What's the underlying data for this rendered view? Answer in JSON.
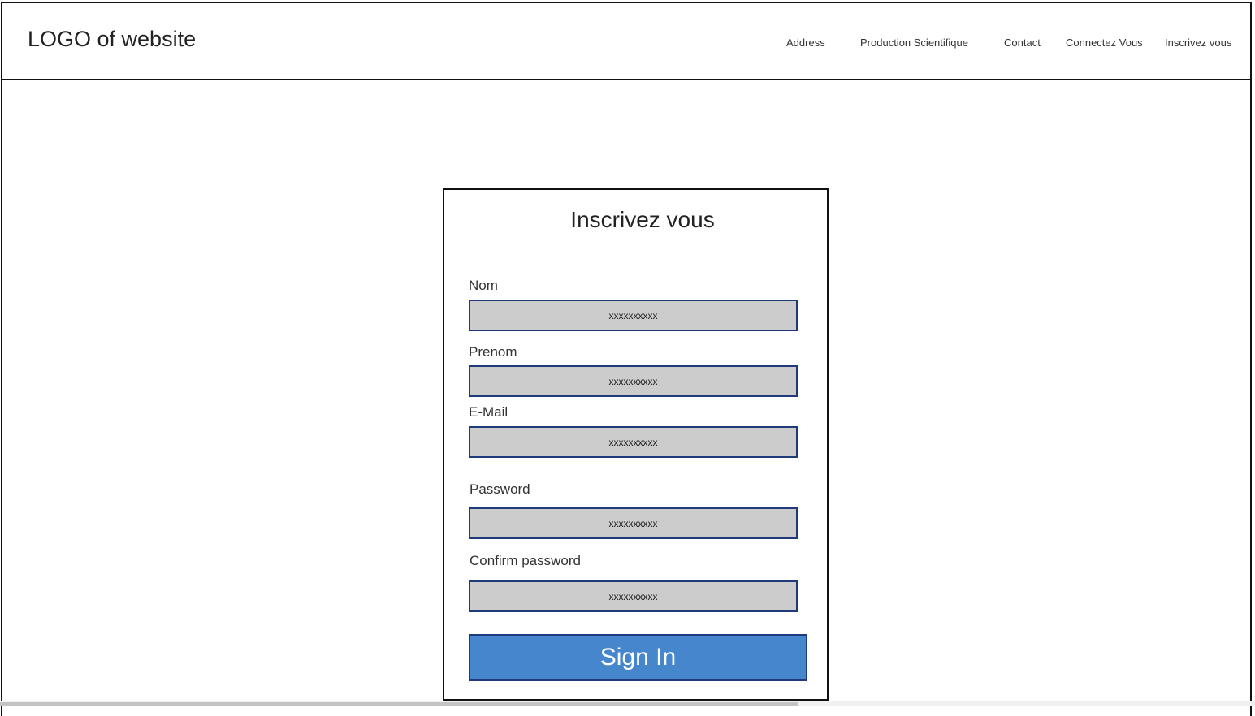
{
  "header": {
    "logo": "LOGO of website",
    "nav": [
      {
        "label": "Address"
      },
      {
        "label": "Production Scientifique"
      },
      {
        "label": "Contact"
      },
      {
        "label": "Connectez Vous"
      },
      {
        "label": "Inscrivez vous"
      }
    ]
  },
  "form": {
    "title": "Inscrivez vous",
    "fields": [
      {
        "label": "Nom",
        "placeholder": "xxxxxxxxxx"
      },
      {
        "label": "Prenom",
        "placeholder": "xxxxxxxxxx"
      },
      {
        "label": "E-Mail",
        "placeholder": "xxxxxxxxxx"
      },
      {
        "label": "Password",
        "placeholder": "xxxxxxxxxx"
      },
      {
        "label": "Confirm password",
        "placeholder": "xxxxxxxxxx"
      }
    ],
    "submit_label": "Sign In"
  },
  "colors": {
    "field_bg": "#cccccc",
    "field_border": "#1f3a7a",
    "button_bg": "#4586cd"
  }
}
